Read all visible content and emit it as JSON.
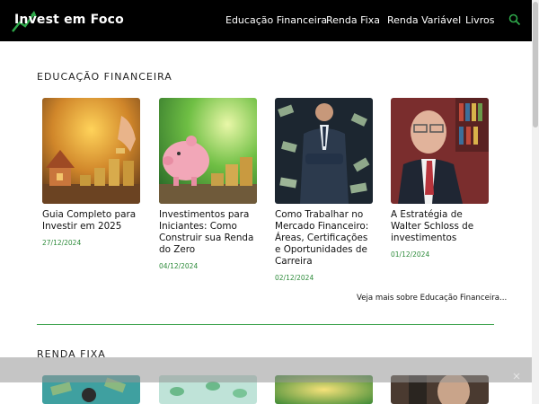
{
  "header": {
    "logo_text": "Invest em Foco",
    "nav": [
      "Educação Financeira",
      "Renda Fixa",
      "Renda Variável",
      "Livros"
    ],
    "colors": {
      "background": "#000000",
      "accent": "#2ea84a"
    }
  },
  "section1": {
    "title": "EDUCAÇÃO FINANCEIRA",
    "cards": [
      {
        "title": "Guia Completo para Investir em 2025",
        "date": "27/12/2024",
        "image": "coins-house-icon"
      },
      {
        "title": "Investimentos para Iniciantes: Como Construir sua Renda do Zero",
        "date": "04/12/2024",
        "image": "piggy-bank-icon"
      },
      {
        "title": "Como Trabalhar no Mercado Financeiro: Áreas, Certificações e Oportunidades de Carreira",
        "date": "02/12/2024",
        "image": "businessman-money-icon"
      },
      {
        "title": "A Estratégia de Walter Schloss de investimentos",
        "date": "01/12/2024",
        "image": "elderly-man-portrait-icon"
      }
    ],
    "see_more": "Veja mais sobre Educação Financeira..."
  },
  "section2": {
    "title": "RENDA FIXA"
  }
}
